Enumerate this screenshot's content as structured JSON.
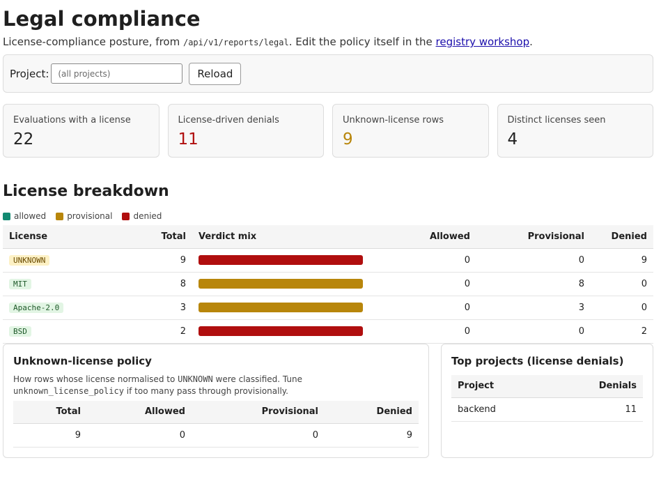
{
  "header": {
    "title": "Legal compliance",
    "subtitle_prefix": "License-compliance posture, from ",
    "endpoint": "/api/v1/reports/legal",
    "subtitle_middle": ". Edit the policy itself in the ",
    "link_text": "registry workshop",
    "subtitle_suffix": "."
  },
  "filter": {
    "label": "Project:",
    "placeholder": "(all projects)",
    "value": "",
    "reload_label": "Reload"
  },
  "cards": [
    {
      "label": "Evaluations with a license",
      "value": "22"
    },
    {
      "label": "License-driven denials",
      "value": "11"
    },
    {
      "label": "Unknown-license rows",
      "value": "9"
    },
    {
      "label": "Distinct licenses seen",
      "value": "4"
    }
  ],
  "breakdown": {
    "title": "License breakdown",
    "legend": [
      {
        "label": "allowed",
        "color": "#138a72"
      },
      {
        "label": "provisional",
        "color": "#b8860b"
      },
      {
        "label": "denied",
        "color": "#b00e0e"
      }
    ],
    "columns": [
      "License",
      "Total",
      "Verdict mix",
      "Allowed",
      "Provisional",
      "Denied"
    ],
    "rows": [
      {
        "license": "UNKNOWN",
        "total": "9",
        "allowed": 0,
        "provisional": 0,
        "denied": 9
      },
      {
        "license": "MIT",
        "total": "8",
        "allowed": 0,
        "provisional": 8,
        "denied": 0
      },
      {
        "license": "Apache-2.0",
        "total": "3",
        "allowed": 0,
        "provisional": 3,
        "denied": 0
      },
      {
        "license": "BSD",
        "total": "2",
        "allowed": 0,
        "provisional": 0,
        "denied": 2
      }
    ]
  },
  "unknown_policy": {
    "title": "Unknown-license policy",
    "desc_1": "How rows whose license normalised to ",
    "desc_code_1": "UNKNOWN",
    "desc_2": " were classified. Tune",
    "desc_code_2": "unknown_license_policy",
    "desc_3": " if too many pass through provisionally.",
    "columns": [
      "Total",
      "Allowed",
      "Provisional",
      "Denied"
    ],
    "row": {
      "total": "9",
      "allowed": "0",
      "provisional": "0",
      "denied": "9"
    }
  },
  "top_projects": {
    "title": "Top projects (license denials)",
    "columns": [
      "Project",
      "Denials"
    ],
    "rows": [
      {
        "project": "backend",
        "denials": "11"
      }
    ]
  }
}
